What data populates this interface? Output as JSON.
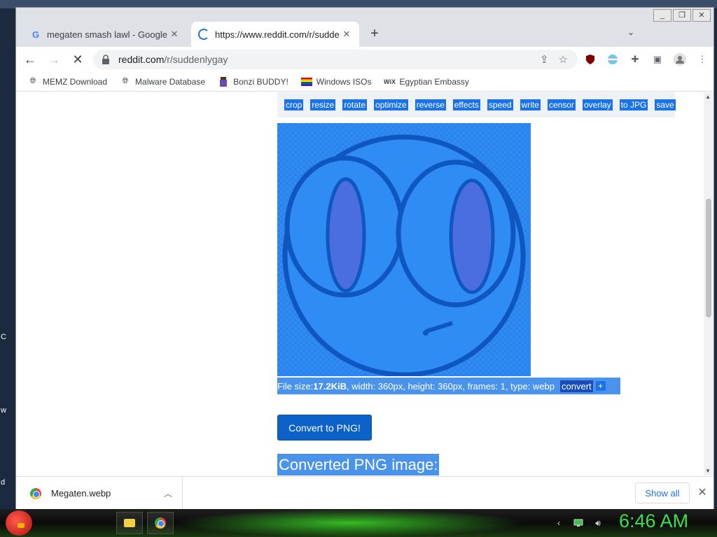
{
  "browser": {
    "tabs": [
      {
        "title": "megaten smash lawl - Google Se",
        "favicon": "google-icon",
        "active": false
      },
      {
        "title": "https://www.reddit.com/r/sudde",
        "favicon": "loading-spinner-icon",
        "active": true
      }
    ],
    "new_tab_label": "+",
    "address": {
      "host": "reddit.com",
      "path": "/r/suddenlygay"
    },
    "bookmarks": [
      {
        "label": "MEMZ Download",
        "icon": "globe-icon"
      },
      {
        "label": "Malware Database",
        "icon": "globe-icon"
      },
      {
        "label": "Bonzi BUDDY!",
        "icon": "bonzi-icon"
      },
      {
        "label": "Windows ISOs",
        "icon": "rainbow-flag-icon"
      },
      {
        "label": "Egyptian Embassy",
        "icon": "wix-icon"
      }
    ]
  },
  "page": {
    "tools": [
      "crop",
      "resize",
      "rotate",
      "optimize",
      "reverse",
      "effects",
      "speed",
      "write",
      "censor",
      "overlay",
      "to JPG",
      "save"
    ],
    "file_info": {
      "prefix": "File size: ",
      "size": "17.2KiB",
      "details": ", width: 360px, height: 360px, frames: 1, type: webp",
      "convert_link": "convert",
      "plus": "+"
    },
    "convert_button": "Convert to PNG!",
    "converted_heading": "Converted PNG image:"
  },
  "downloads": {
    "filename": "Megaten.webp",
    "show_all": "Show all"
  },
  "taskbar": {
    "clock": "6:46 AM"
  },
  "desktop_edge_text": [
    "C",
    "w",
    "d"
  ],
  "colors": {
    "accent": "#1a73e8",
    "preview_bg": "#2f8cf5",
    "clock": "#37e24a"
  }
}
